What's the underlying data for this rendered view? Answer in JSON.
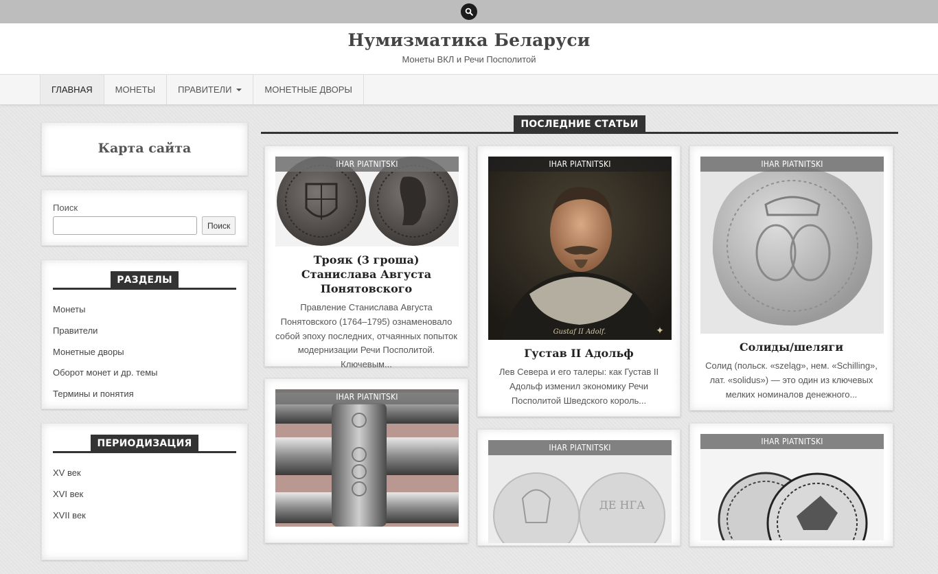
{
  "site": {
    "title": "Нумизматика Беларуси",
    "description": "Монеты ВКЛ и Речи Посполитой"
  },
  "nav": [
    {
      "label": "Главная",
      "active": true
    },
    {
      "label": "Монеты"
    },
    {
      "label": "Правители",
      "has_dropdown": true
    },
    {
      "label": "Монетные дворы"
    }
  ],
  "sidebar": {
    "map_title": "Карта сайта",
    "search_label": "Поиск",
    "search_button": "Поиск",
    "sections_title": "Разделы",
    "sections": [
      "Монеты",
      "Правители",
      "Монетные дворы",
      "Оборот монет и др. темы",
      "Термины и понятия"
    ],
    "periods_title": "Периодизация",
    "periods": [
      "XV век",
      "XVI век",
      "XVII век"
    ]
  },
  "main": {
    "section_title": "Последние статьи",
    "posts": [
      {
        "author": "Ihar Piatnitski",
        "title": "Трояк (3 гроша) Станислава Августа Понятовского",
        "excerpt": "Правление Станислава Августа Понятовского (1764–1795) ознаменовало собой эпоху последних, отчаянных попыток модернизации Речи Посполитой. Ключевым..."
      },
      {
        "author": "Ihar Piatnitski",
        "title": "Густав II Адольф",
        "excerpt": "Лев Севера и его талеры: как Густав II Адольф изменил экономику Речи Посполитой Шведского король...",
        "caption": "Gustaf II Adolf."
      },
      {
        "author": "Ihar Piatnitski",
        "title": "Солиды/шеляги",
        "excerpt": "Солид (польск. «szeląg», нем. «Schilling», лат. «solidus») — это один из ключевых мелких номиналов денежного..."
      },
      {
        "author": "Ihar Piatnitski"
      },
      {
        "author": "Ihar Piatnitski",
        "coin_text": "ДЕ НГА"
      },
      {
        "author": "Ihar Piatnitski"
      }
    ]
  }
}
